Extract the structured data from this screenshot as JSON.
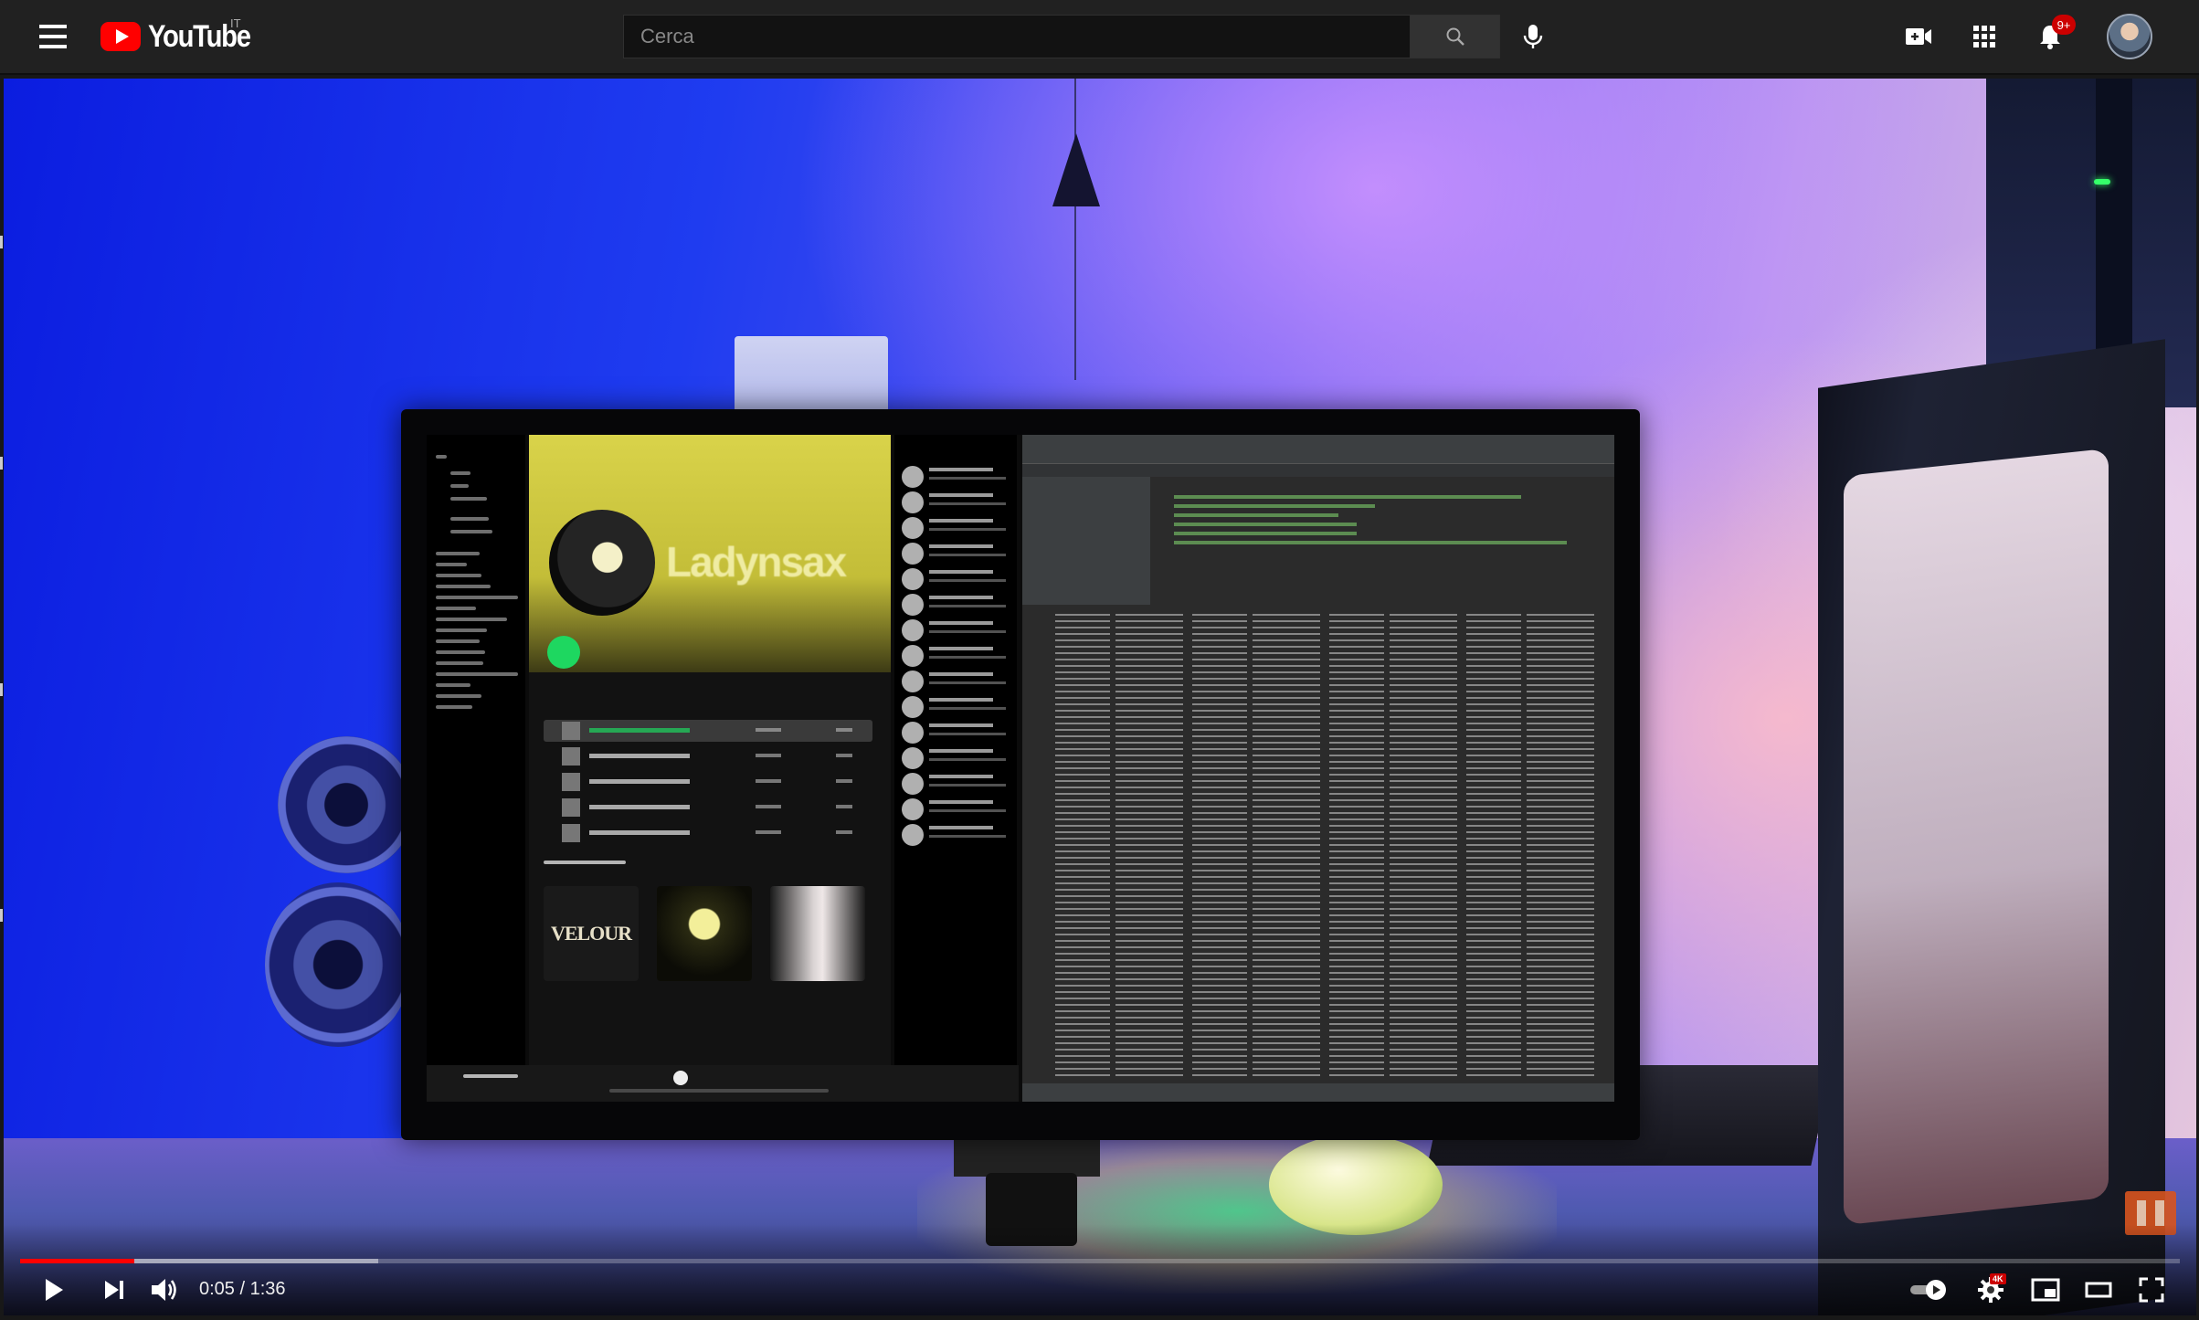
{
  "masthead": {
    "logo_text": "YouTube",
    "country_code": "IT",
    "search": {
      "placeholder": "Cerca",
      "value": ""
    },
    "notifications_badge": "9+",
    "icons": [
      "menu-icon",
      "search-icon",
      "mic-icon",
      "create-video-icon",
      "apps-grid-icon",
      "bell-icon"
    ]
  },
  "video": {
    "scene_text": {
      "artist_name": "Ladynsax",
      "album_title": "VELOUR"
    }
  },
  "player_controls": {
    "current_time": "0:05",
    "separator": " / ",
    "duration": "1:36",
    "time_display": "0:05 / 1:36",
    "progress_fraction": 0.053,
    "buffered_fraction": 0.166,
    "quality_badge": "4K",
    "autoplay_on": true,
    "icons": [
      "play-icon",
      "next-icon",
      "volume-icon",
      "autoplay-toggle-icon",
      "settings-gear-icon",
      "miniplayer-icon",
      "theater-mode-icon",
      "fullscreen-icon"
    ]
  },
  "colors": {
    "masthead_bg": "#212121",
    "accent_red": "#ff0000",
    "search_bg": "#121212",
    "search_button_bg": "#323232"
  }
}
